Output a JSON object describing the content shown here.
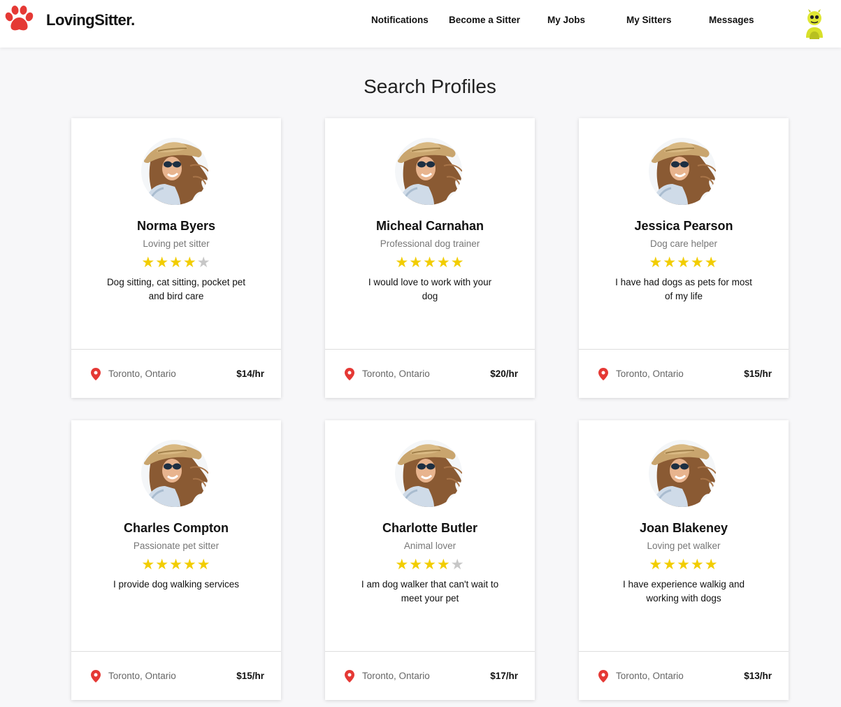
{
  "brand": {
    "name": "LovingSitter.",
    "color": "#e53935"
  },
  "nav": {
    "items": [
      {
        "label": "Notifications"
      },
      {
        "label": "Become a Sitter"
      },
      {
        "label": "My Jobs"
      },
      {
        "label": "My Sitters"
      },
      {
        "label": "Messages"
      }
    ]
  },
  "page": {
    "title": "Search Profiles"
  },
  "colors": {
    "star_filled": "#f2cd00",
    "star_empty": "#c7c7c7",
    "pin": "#e53935"
  },
  "profiles": [
    {
      "name": "Norma Byers",
      "tagline": "Loving pet sitter",
      "rating": 4,
      "description": "Dog sitting, cat sitting, pocket pet and bird care",
      "location": "Toronto, Ontario",
      "rate": "$14/hr"
    },
    {
      "name": "Micheal Carnahan",
      "tagline": "Professional dog trainer",
      "rating": 5,
      "description": "I would love to work with your dog",
      "location": "Toronto, Ontario",
      "rate": "$20/hr"
    },
    {
      "name": "Jessica Pearson",
      "tagline": "Dog care helper",
      "rating": 5,
      "description": "I have had dogs as pets for most of my life",
      "location": "Toronto, Ontario",
      "rate": "$15/hr"
    },
    {
      "name": "Charles Compton",
      "tagline": "Passionate pet sitter",
      "rating": 5,
      "description": "I provide dog walking services",
      "location": "Toronto, Ontario",
      "rate": "$15/hr"
    },
    {
      "name": "Charlotte Butler",
      "tagline": "Animal lover",
      "rating": 4,
      "description": "I am dog walker that can't wait to meet your pet",
      "location": "Toronto, Ontario",
      "rate": "$17/hr"
    },
    {
      "name": "Joan Blakeney",
      "tagline": "Loving pet walker",
      "rating": 5,
      "description": "I have experience walkig and working with dogs",
      "location": "Toronto, Ontario",
      "rate": "$13/hr"
    }
  ]
}
